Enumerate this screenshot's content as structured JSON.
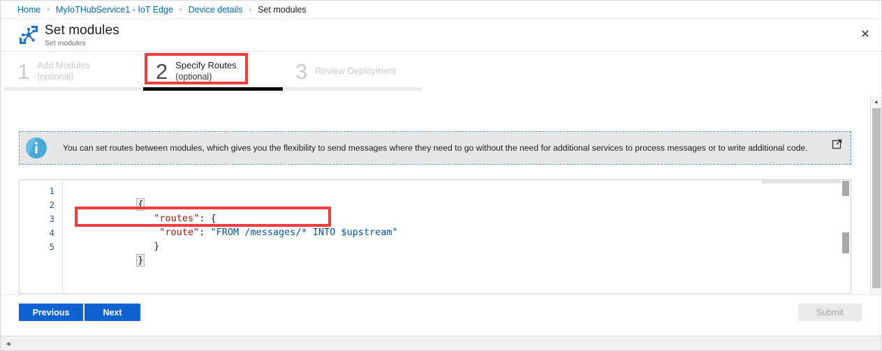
{
  "breadcrumb": {
    "items": [
      {
        "label": "Home",
        "current": false
      },
      {
        "label": "MyIoTHubService1 - IoT Edge",
        "current": false
      },
      {
        "label": "Device details",
        "current": false
      },
      {
        "label": "Set modules",
        "current": true
      }
    ],
    "separator": "›"
  },
  "header": {
    "title": "Set modules",
    "subtitle": "Set modules",
    "icon": "iot-edge-modules-icon",
    "close_label": "✕"
  },
  "steps": [
    {
      "number": "1",
      "label": "Add Modules",
      "optional": "(optional)",
      "active": false
    },
    {
      "number": "2",
      "label": "Specify Routes",
      "optional": "(optional)",
      "active": true
    },
    {
      "number": "3",
      "label": "Review Deployment",
      "optional": "",
      "active": false
    }
  ],
  "info_banner": {
    "icon": "info-circle-icon",
    "text": "You can set routes between modules, which gives you the flexibility to send messages where they need to go without the need for additional services to process messages or to write additional code.",
    "external_link_icon": "external-link-icon"
  },
  "editor": {
    "line_numbers": [
      "1",
      "2",
      "3",
      "4",
      "5"
    ],
    "lines": [
      {
        "indent": 0,
        "tokens": [
          {
            "t": "{",
            "k": "pun-bracket"
          }
        ]
      },
      {
        "indent": 1,
        "tokens": [
          {
            "t": "\"routes\"",
            "k": "key"
          },
          {
            "t": ": {",
            "k": "pun"
          }
        ]
      },
      {
        "indent": 2,
        "tokens": [
          {
            "t": "\"route\"",
            "k": "key"
          },
          {
            "t": ": ",
            "k": "pun"
          },
          {
            "t": "\"FROM /messages/* INTO $upstream\"",
            "k": "str"
          }
        ]
      },
      {
        "indent": 1,
        "tokens": [
          {
            "t": "}",
            "k": "pun"
          }
        ]
      },
      {
        "indent": 0,
        "tokens": [
          {
            "t": "}",
            "k": "pun-bracket"
          }
        ]
      }
    ]
  },
  "footer": {
    "previous_label": "Previous",
    "next_label": "Next",
    "submit_label": "Submit",
    "submit_disabled": true
  },
  "scrollbars": {
    "vertical_up": "▲",
    "vertical_down": "▼",
    "horizontal_left": "◀"
  },
  "colors": {
    "link": "#0069c0",
    "primary_button": "#0f62d0",
    "annotation_red": "#ef3c3c",
    "active_step_rule": "#0a0a0a",
    "inactive_rule": "#ebebeb",
    "info_border": "#4aa8e0",
    "json_key": "#a31515",
    "json_string": "#0451a5",
    "line_number": "#2b579a"
  },
  "annotations": [
    {
      "name": "step-2-highlight"
    },
    {
      "name": "route-line-highlight"
    }
  ]
}
